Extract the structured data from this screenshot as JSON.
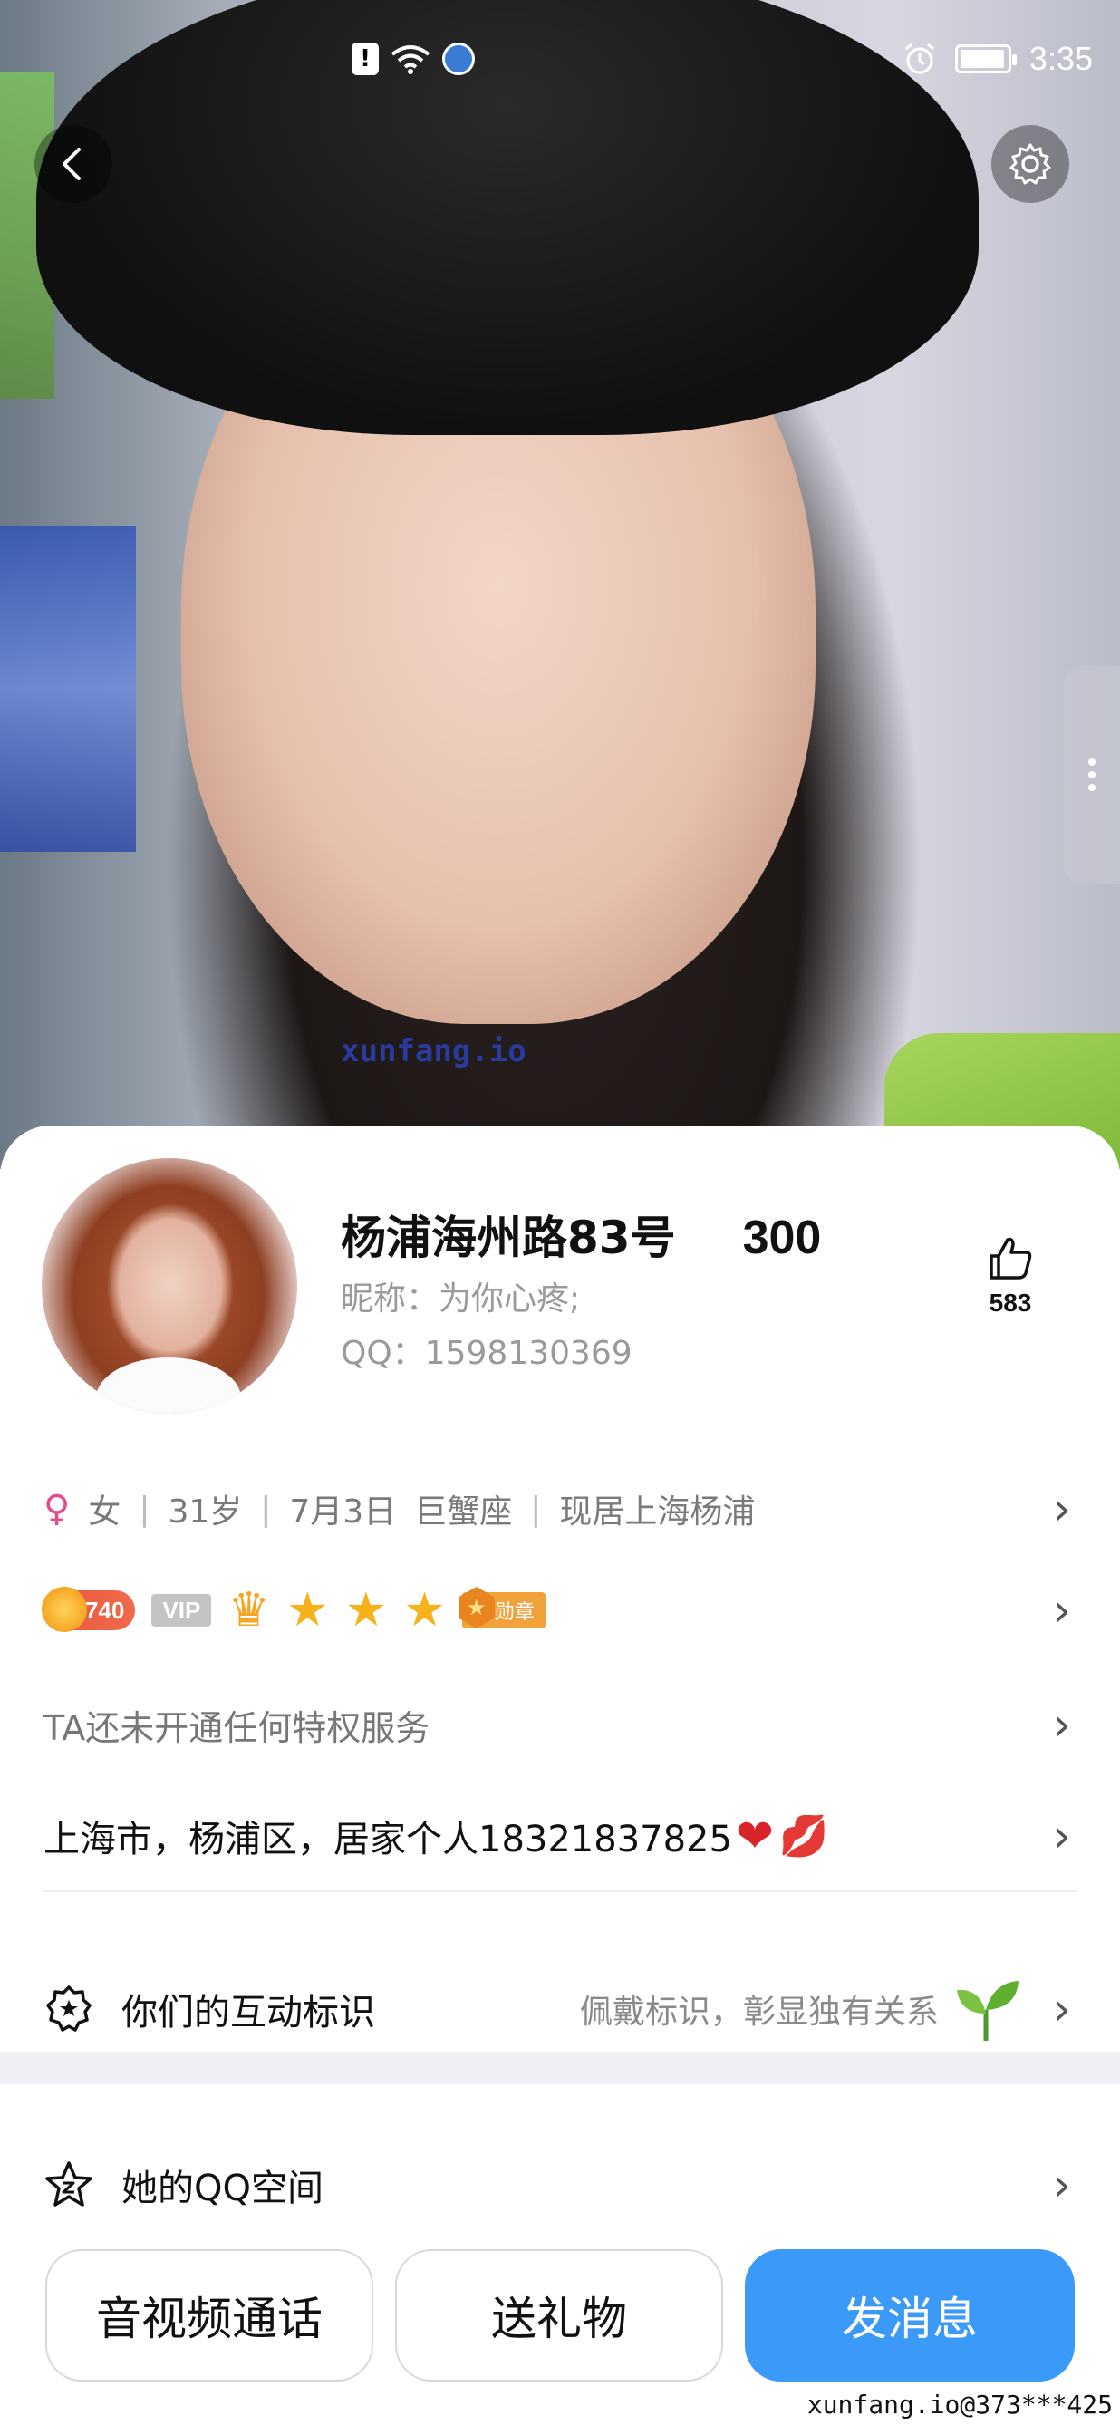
{
  "status_bar": {
    "left_icons": [
      "alert-icon",
      "wifi-6-icon",
      "browser-icon"
    ],
    "wifi_label": "6",
    "time": "3:35"
  },
  "hero": {
    "watermark": "xunfang.io"
  },
  "profile": {
    "name": "杨浦海州路83号",
    "number": "300",
    "nickname": "昵称：为你心疼;",
    "qq": "QQ：1598130369",
    "likes": "583"
  },
  "basic_info": {
    "gender": "女",
    "age": "31岁",
    "birthday": "7月3日",
    "zodiac": "巨蟹座",
    "residence": "现居上海杨浦",
    "separator": "|"
  },
  "badges": {
    "level": "740",
    "vip": "VIP",
    "medal": "勋章"
  },
  "privilege_text": "TA还未开通任何特权服务",
  "signature": {
    "text": "上海市，杨浦区，居家个人18321837825",
    "emoji_heart": "❤",
    "emoji_kiss": "💋"
  },
  "interaction": {
    "label": "你们的互动标识",
    "hint": "佩戴标识，彰显独有关系"
  },
  "qzone": {
    "label": "她的QQ空间"
  },
  "actions": {
    "call": "音视频通话",
    "gift": "送礼物",
    "message": "发消息"
  },
  "footer_watermark": "xunfang.io@373***425",
  "colors": {
    "primary_button": "#3b9af7",
    "female_icon": "#e64a8e",
    "level_badge": "#e8563f",
    "star": "#f5b21a"
  }
}
